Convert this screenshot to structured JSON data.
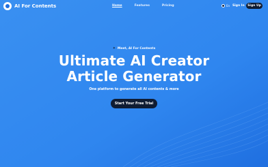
{
  "brand": {
    "name": "AI For Contents"
  },
  "nav": {
    "links": [
      {
        "label": "Home"
      },
      {
        "label": "Features"
      },
      {
        "label": "Pricing"
      }
    ],
    "language": "En",
    "sign_in": "Sign In",
    "sign_up": "Sign Up"
  },
  "hero": {
    "badge": "Meet, AI For Contents",
    "title_line1": "Ultimate AI Creator",
    "title_line2": "Article Generator",
    "subtitle": "One platform to generate all AI contents & more",
    "cta": "Start Your Free Trial"
  },
  "colors": {
    "background": "#2f86ef",
    "dark_button": "#0f1c33",
    "text": "#ffffff"
  }
}
